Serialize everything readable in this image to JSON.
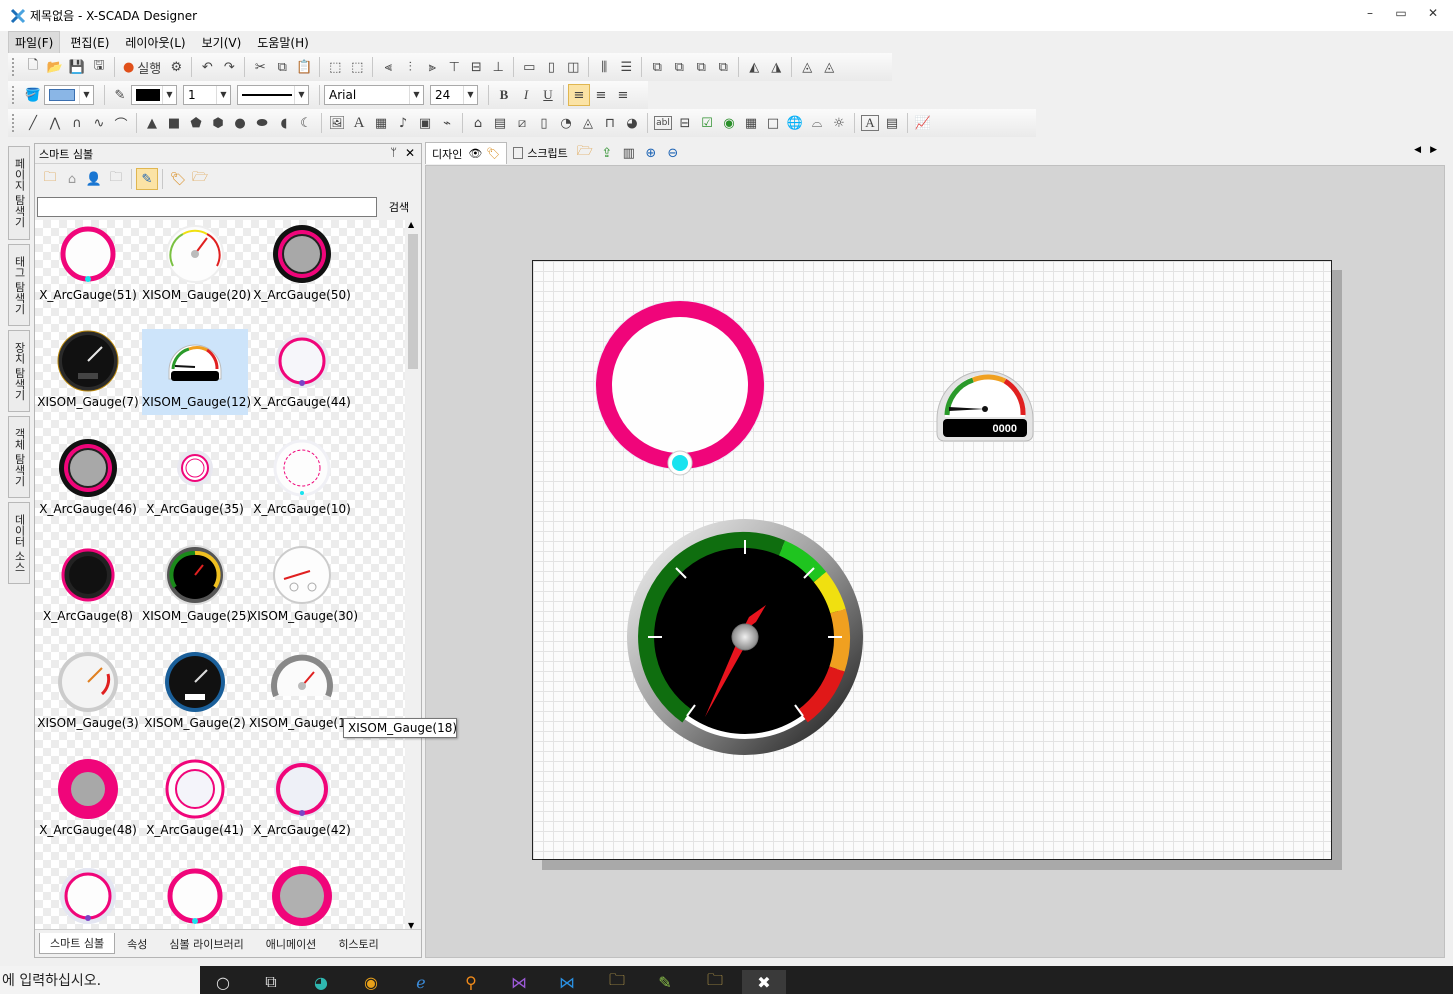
{
  "window": {
    "title": "제목없음 - X-SCADA Designer",
    "controls": [
      "–",
      "▭",
      "✕"
    ]
  },
  "menu": [
    "파일(F)",
    "편집(E)",
    "레이아웃(L)",
    "보기(V)",
    "도움말(H)"
  ],
  "toolbar": {
    "run_label": "실행",
    "line_width": "1",
    "font_name": "Arial",
    "font_size": "24",
    "bold": "B",
    "italic": "I",
    "underline": "U",
    "text_widget": "abl"
  },
  "side_tabs": [
    "페이지 탐색기",
    "태그 탐색기",
    "장치 탐색기",
    "객체 탐색기",
    "데이터 소스"
  ],
  "panel": {
    "title": "스마트 심볼",
    "pin": "ᛘ",
    "close": "✕",
    "search_button": "검색",
    "search_value": "",
    "items": [
      {
        "label": "X_ArcGauge(51)",
        "kind": "arc-thin-pink"
      },
      {
        "label": "XISOM_Gauge(20)",
        "kind": "gauge-light"
      },
      {
        "label": "X_ArcGauge(50)",
        "kind": "arc-dark-pink"
      },
      {
        "label": "XISOM_Gauge(7)",
        "kind": "gauge-dark"
      },
      {
        "label": "XISOM_Gauge(12)",
        "kind": "gauge-semi"
      },
      {
        "label": "X_ArcGauge(44)",
        "kind": "arc-light"
      },
      {
        "label": "X_ArcGauge(46)",
        "kind": "arc-dark-pink"
      },
      {
        "label": "X_ArcGauge(35)",
        "kind": "arc-small"
      },
      {
        "label": "X_ArcGauge(10)",
        "kind": "arc-dashed"
      },
      {
        "label": "X_ArcGauge(8)",
        "kind": "arc-knob"
      },
      {
        "label": "XISOM_Gauge(25)",
        "kind": "gauge-black"
      },
      {
        "label": "XISOM_Gauge(30)",
        "kind": "gauge-white"
      },
      {
        "label": "XISOM_Gauge(3)",
        "kind": "gauge-silver"
      },
      {
        "label": "XISOM_Gauge(2)",
        "kind": "gauge-blue"
      },
      {
        "label": "XISOM_Gauge(18)",
        "kind": "gauge-chrome"
      },
      {
        "label": "X_ArcGauge(48)",
        "kind": "arc-filled"
      },
      {
        "label": "X_ArcGauge(41)",
        "kind": "arc-double"
      },
      {
        "label": "X_ArcGauge(42)",
        "kind": "arc-ring"
      },
      {
        "label": "",
        "kind": "arc-thin-light"
      },
      {
        "label": "",
        "kind": "arc-thin-pink"
      },
      {
        "label": "",
        "kind": "arc-filled-gray"
      }
    ],
    "selected_index": 4,
    "bottom_tabs": [
      "스마트 심볼",
      "속성",
      "심볼 라이브러리",
      "애니메이션",
      "히스토리"
    ]
  },
  "doc_tabs": [
    "디자인",
    "스크립트"
  ],
  "canvas": {
    "small_gauge_readout": "0000"
  },
  "tooltip": "XISOM_Gauge(18)",
  "taskbar": {
    "search_text": "에 입력하십시오."
  },
  "colors": {
    "accent_pink": "#f0057a",
    "cyan": "#19e3ef",
    "canvas_bg": "#fbfbfb",
    "design_bg": "#d4d4d4"
  }
}
